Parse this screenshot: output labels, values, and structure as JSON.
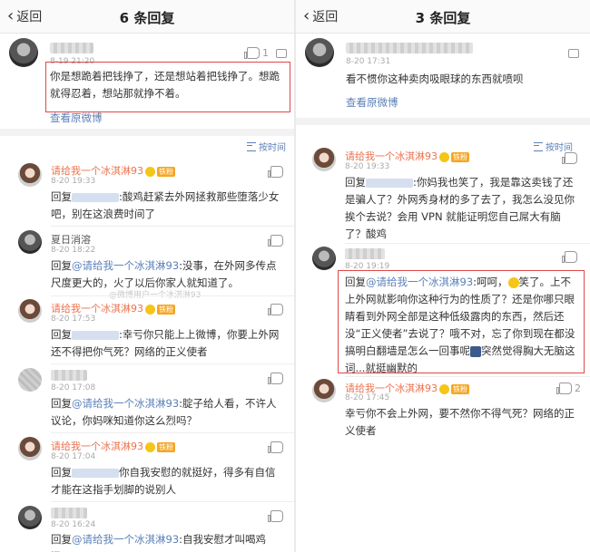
{
  "left": {
    "back_label": "返回",
    "title": "6 条回复",
    "main_comment": {
      "time": "8-19 21:20",
      "likes": "1",
      "text": "你是想跪着把钱挣了，还是想站着把钱挣了。想跪就得忍着，想站那就挣不着。",
      "view_original": "查看原微博"
    },
    "sort_label": "按时间",
    "replies": [
      {
        "name": "请给我一个冰淇淋93",
        "badge": "铁粉",
        "time": "8-20 19:33",
        "prefix": "回复",
        "text": ":酸鸡赶紧去外网拯救那些堕落少女吧，别在这浪费时间了"
      },
      {
        "name": "夏日消溶",
        "time": "8-20 18:22",
        "prefix": "回复",
        "mention": "@请给我一个冰淇淋93",
        "text": ":没事，在外网多传点尺度更大的，火了以后你家人就知道了。"
      },
      {
        "name": "请给我一个冰淇淋93",
        "badge": "铁粉",
        "time": "8-20 17:53",
        "prefix": "回复",
        "text": ":幸亏你只能上上微博，你要上外网还不得把你气死？网络的正义使者"
      },
      {
        "time": "8-20 17:08",
        "prefix": "回复",
        "mention": "@请给我一个冰淇淋93",
        "text": ":腚子给人看，不许人议论，你妈咪知道你这么烈吗？"
      },
      {
        "name": "请给我一个冰淇淋93",
        "badge": "铁粉",
        "time": "8-20 17:04",
        "prefix": "回复",
        "text": "你自我安慰的就挺好，得多有自信才能在这指手划脚的说别人"
      },
      {
        "time": "8-20 16:24",
        "prefix": "回复",
        "mention": "@请给我一个冰淇淋93",
        "text": ":自我安慰才叫喝鸡汤。"
      }
    ],
    "watermark": "@微博用户一个冰淇淋93"
  },
  "right": {
    "back_label": "返回",
    "title": "3 条回复",
    "main_comment": {
      "time": "8-20 17:31",
      "text": "看不惯你这种卖肉吸眼球的东西就喷呗",
      "view_original": "查看原微博"
    },
    "sort_label": "按时间",
    "replies": [
      {
        "name": "请给我一个冰淇淋93",
        "badge": "铁粉",
        "time": "8-20 19:33",
        "prefix": "回复",
        "text": ":你妈我也笑了，我是靠这卖钱了还是骗人了？外网秀身材的多了去了，我怎么没见你挨个去说？会用 VPN 就能证明您自己屌大有脑了？酸鸡"
      },
      {
        "time": "8-20 19:19",
        "prefix": "回复",
        "mention": "@请给我一个冰淇淋93",
        "text_a": ":呵呵，",
        "text_b": "笑了。上不上外网就影响你这种行为的性质了？还是你哪只眼睛看到外网全部是这种低级露肉的东西，然后还没“正义使者”去说了？哦不对，忘了你到现在都没搞明白翻墙是怎么一回事呢",
        "text_c": "突然觉得胸大无脑这词...就挺幽默的"
      },
      {
        "name": "请给我一个冰淇淋93",
        "badge": "铁粉",
        "time": "8-20 17:45",
        "likes": "2",
        "text": "幸亏你不会上外网，要不然你不得气死？网络的正义使者"
      }
    ]
  }
}
